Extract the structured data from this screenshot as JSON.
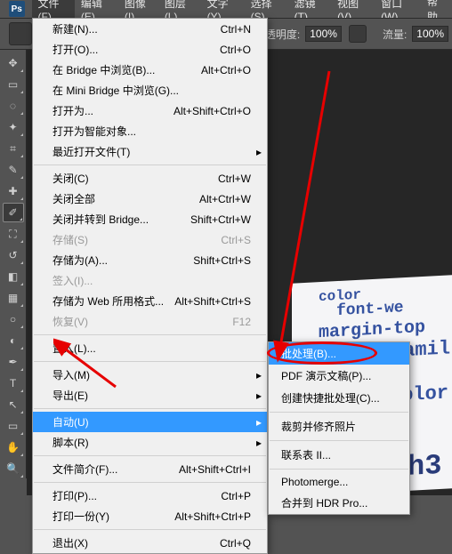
{
  "menubar": {
    "items": [
      "文件(F)",
      "编辑(E)",
      "图像(I)",
      "图层(L)",
      "文字(Y)",
      "选择(S)",
      "滤镜(T)",
      "视图(V)",
      "窗口(W)",
      "帮助"
    ]
  },
  "options": {
    "opacity_label": "不透明度:",
    "opacity_value": "100%",
    "flow_label": "流量:",
    "flow_value": "100%"
  },
  "file_menu": {
    "new": {
      "label": "新建(N)...",
      "shortcut": "Ctrl+N"
    },
    "open": {
      "label": "打开(O)...",
      "shortcut": "Ctrl+O"
    },
    "browse_bridge": {
      "label": "在 Bridge 中浏览(B)...",
      "shortcut": "Alt+Ctrl+O"
    },
    "browse_mini": {
      "label": "在 Mini Bridge 中浏览(G)...",
      "shortcut": ""
    },
    "open_as": {
      "label": "打开为...",
      "shortcut": "Alt+Shift+Ctrl+O"
    },
    "open_smart": {
      "label": "打开为智能对象...",
      "shortcut": ""
    },
    "recent": {
      "label": "最近打开文件(T)",
      "shortcut": ""
    },
    "close": {
      "label": "关闭(C)",
      "shortcut": "Ctrl+W"
    },
    "close_all": {
      "label": "关闭全部",
      "shortcut": "Alt+Ctrl+W"
    },
    "close_goto": {
      "label": "关闭并转到 Bridge...",
      "shortcut": "Shift+Ctrl+W"
    },
    "save": {
      "label": "存储(S)",
      "shortcut": "Ctrl+S"
    },
    "save_as": {
      "label": "存储为(A)...",
      "shortcut": "Shift+Ctrl+S"
    },
    "checkin": {
      "label": "签入(I)...",
      "shortcut": ""
    },
    "save_web": {
      "label": "存储为 Web 所用格式...",
      "shortcut": "Alt+Shift+Ctrl+S"
    },
    "revert": {
      "label": "恢复(V)",
      "shortcut": "F12"
    },
    "place": {
      "label": "置入(L)...",
      "shortcut": ""
    },
    "import": {
      "label": "导入(M)",
      "shortcut": ""
    },
    "export": {
      "label": "导出(E)",
      "shortcut": ""
    },
    "automate": {
      "label": "自动(U)",
      "shortcut": ""
    },
    "scripts": {
      "label": "脚本(R)",
      "shortcut": ""
    },
    "file_info": {
      "label": "文件简介(F)...",
      "shortcut": "Alt+Shift+Ctrl+I"
    },
    "print": {
      "label": "打印(P)...",
      "shortcut": "Ctrl+P"
    },
    "print_one": {
      "label": "打印一份(Y)",
      "shortcut": "Alt+Shift+Ctrl+P"
    },
    "exit": {
      "label": "退出(X)",
      "shortcut": "Ctrl+Q"
    }
  },
  "automate_submenu": {
    "batch": "批处理(B)...",
    "pdf": "PDF 演示文稿(P)...",
    "droplet": "创建快捷批处理(C)...",
    "crop": "裁剪并修齐照片",
    "contact": "联系表 II...",
    "photomerge": "Photomerge...",
    "hdr": "合并到 HDR Pro..."
  },
  "preview_text": {
    "l1": "color",
    "l2": "font-we",
    "l3": "margin-top",
    "l4": "font-famil",
    "l5": "color",
    "l6": "h3"
  },
  "ps_logo": "Ps"
}
